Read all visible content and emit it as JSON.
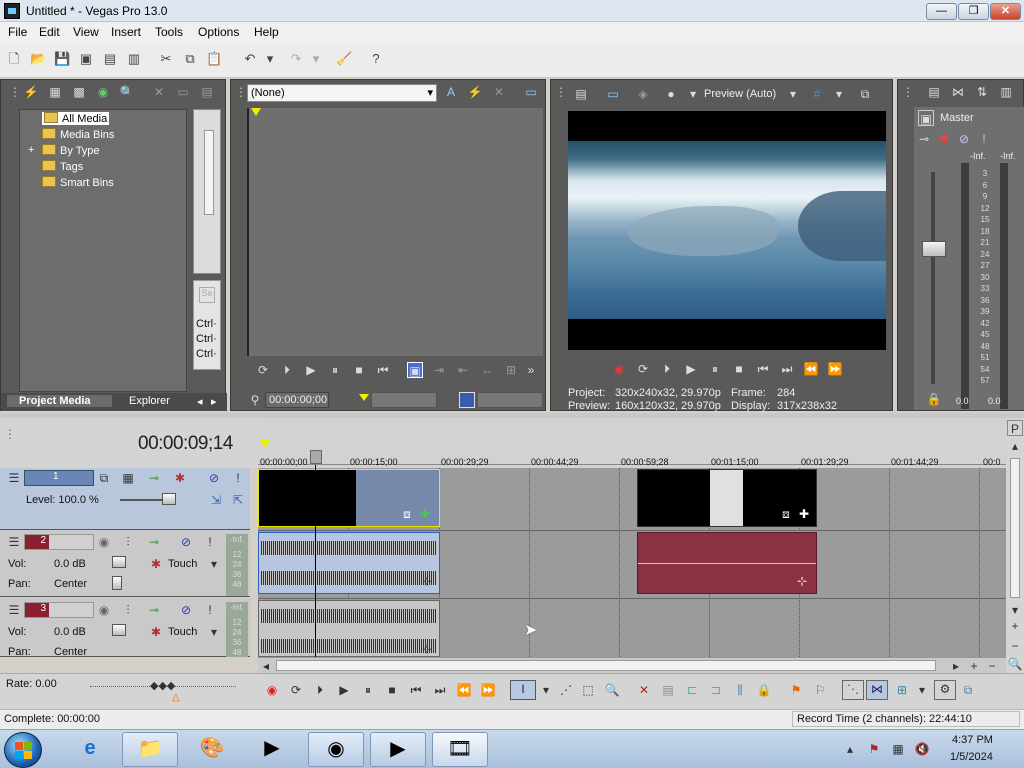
{
  "window": {
    "title": "Untitled * - Vegas Pro 13.0",
    "min": "—",
    "max": "❐",
    "close": "✕"
  },
  "menu": [
    "File",
    "Edit",
    "View",
    "Insert",
    "Tools",
    "Options",
    "Help"
  ],
  "project_media": {
    "tree": [
      "All Media",
      "Media Bins",
      "By Type",
      "Tags",
      "Smart Bins"
    ],
    "expander": "+",
    "tabs": [
      "Project Media",
      "Explorer"
    ],
    "ctrl": [
      "Ctrl·",
      "Ctrl·",
      "Ctrl·"
    ]
  },
  "trimmer": {
    "dropdown": "(None)",
    "timecode": "00:00:00;00"
  },
  "preview": {
    "mode": "Preview (Auto)",
    "project_label": "Project:",
    "project_value": "320x240x32, 29.970p",
    "preview_label": "Preview:",
    "preview_value": "160x120x32, 29.970p",
    "frame_label": "Frame:",
    "frame_value": "284",
    "display_label": "Display:",
    "display_value": "317x238x32"
  },
  "master": {
    "title": "Master",
    "scale_left": "-Inf.",
    "scale_right": "-Inf.",
    "db_marks": [
      "3",
      "6",
      "9",
      "12",
      "15",
      "18",
      "21",
      "24",
      "27",
      "30",
      "33",
      "36",
      "39",
      "42",
      "45",
      "48",
      "51",
      "54",
      "57"
    ],
    "bottom_left": "0.0",
    "bottom_right": "0.0"
  },
  "timeline": {
    "timecode": "00:00:09;14",
    "ruler": [
      "00:00:00;00",
      "00:00:15;00",
      "00:00:29;29",
      "00:00:44;29",
      "00:00:59;28",
      "00:01:15;00",
      "00:01:29;29",
      "00:01:44;29",
      "00:0"
    ],
    "tracks": [
      {
        "num": "1",
        "level": "Level: 100.0 %"
      },
      {
        "num": "2",
        "vol_label": "Vol:",
        "vol": "0.0 dB",
        "pan_label": "Pan:",
        "pan": "Center",
        "mode": "Touch",
        "meter_top": "-Inf.",
        "meter_marks": [
          "12",
          "24",
          "36",
          "48"
        ]
      },
      {
        "num": "3",
        "vol_label": "Vol:",
        "vol": "0.0 dB",
        "pan_label": "Pan:",
        "pan": "Center",
        "mode": "Touch",
        "meter_top": "-Inf.",
        "meter_marks": [
          "12",
          "24",
          "36",
          "48"
        ]
      }
    ],
    "rate": "Rate: 0.00"
  },
  "status": {
    "left": "Complete: 00:00:00",
    "right": "Record Time (2 channels): 22:44:10"
  },
  "taskbar": {
    "time": "4:37 PM",
    "date": "1/5/2024"
  },
  "colors": {
    "panel": "#5a5a5a",
    "video_event": "#7789aa",
    "audio_event_selected": "#b7c6e0",
    "audio_event": "#8a3242",
    "track_header": "#b9c7dd"
  }
}
